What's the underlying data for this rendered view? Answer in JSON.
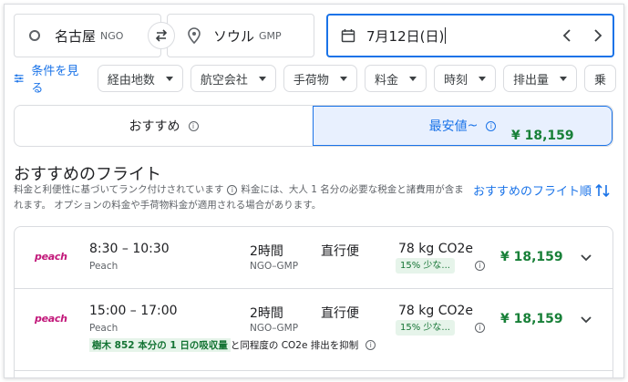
{
  "search": {
    "origin_city": "名古屋",
    "origin_code": "NGO",
    "dest_city": "ソウル",
    "dest_code": "GMP",
    "date": "7月12日(日)"
  },
  "filters": {
    "conditions_label": "条件を見る",
    "chips": [
      "経由地数",
      "航空会社",
      "手荷物",
      "料金",
      "時刻",
      "排出量",
      "乗"
    ]
  },
  "tabs": {
    "recommended": "おすすめ",
    "cheapest": "最安値",
    "cheapest_price": "¥ 18,159",
    "cheapest_suffix": "~"
  },
  "results_header": {
    "title": "おすすめのフライト",
    "desc_part1": "料金と利便性に基づいてランク付けされています",
    "desc_part2": "料金には、大人 1 名分の必要な税金と諸費用が含まれます。 オプションの料金や手荷物料金が適用される場合があります。",
    "sort_label": "おすすめのフライト順"
  },
  "flights": [
    {
      "airline_logo": "peach",
      "times": "8:30 – 10:30",
      "airline": "Peach",
      "duration": "2時間",
      "route": "NGO–GMP",
      "stops": "直行便",
      "co2": "78 kg CO2e",
      "co2_badge": "15% 少な...",
      "price": "¥ 18,159"
    },
    {
      "airline_logo": "peach",
      "times": "15:00 – 17:00",
      "airline": "Peach",
      "duration": "2時間",
      "route": "NGO–GMP",
      "stops": "直行便",
      "co2": "78 kg CO2e",
      "co2_badge": "15% 少な...",
      "price": "¥ 18,159",
      "eco_highlight": "樹木 852 本分の 1 日の吸収量",
      "eco_rest": "と同程度の CO2e 排出を抑制"
    }
  ],
  "colors": {
    "accent": "#1a73e8",
    "price_green": "#188038",
    "brand_peach": "#c2187a"
  }
}
